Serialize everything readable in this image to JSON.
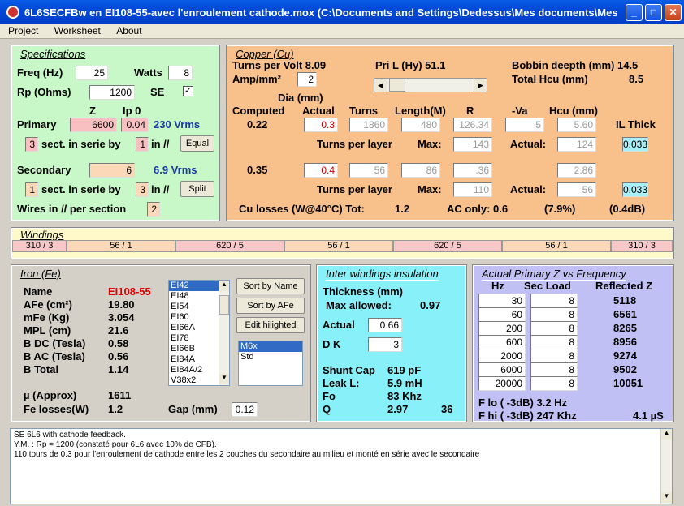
{
  "window": {
    "title": "6L6SECFBw en EI108-55-avec l'enroulement cathode.mox  (C:\\Documents and Settings\\Dedessus\\Mes documents\\Mes ...",
    "min": "_",
    "max": "□",
    "close": "✕"
  },
  "menu": [
    "Project",
    "Worksheet",
    "About"
  ],
  "spec": {
    "title": "Specifications",
    "freq_label": "Freq (Hz)",
    "freq": "25",
    "watts_label": "Watts",
    "watts": "8",
    "rp_label": "Rp (Ohms)",
    "rp": "1200",
    "se_label": "SE",
    "se_check": "✓",
    "z_label": "Z",
    "ip0_label": "Ip 0",
    "primary_label": "Primary",
    "primary_z": "6600",
    "primary_ip0": "0.04",
    "primary_vrms": "230 Vrms",
    "p_sect": "3",
    "sect_label": "sect. in serie by",
    "p_par": "1",
    "in_label": "in //",
    "equal": "Equal",
    "secondary_label": "Secondary",
    "secondary_z": "6",
    "secondary_vrms": "6.9 Vrms",
    "s_sect": "1",
    "s_par": "3",
    "split": "Split",
    "wires_label": "Wires in // per section",
    "wires": "2"
  },
  "copper": {
    "title": "Copper (Cu)",
    "tpv": "Turns per Volt  8.09",
    "pri_l": "Pri L (Hy)  51.1",
    "bobbin": "Bobbin deepth (mm) 14.5",
    "amp_label": "Amp/mm²",
    "amp": "2",
    "total_hcu": "Total Hcu (mm)",
    "total_hcu_val": "8.5",
    "dia": "Dia (mm)",
    "h_computed": "Computed",
    "h_actual": "Actual",
    "h_turns": "Turns",
    "h_length": "Length(M)",
    "h_r": "R",
    "h_va": "-Va",
    "h_hcu": "Hcu (mm)",
    "il_thick": "IL Thick",
    "r1": {
      "computed": "0.22",
      "actual": "0.3",
      "turns": "1860",
      "length": "480",
      "r": "126.34",
      "va": "5",
      "hcu": "5.60"
    },
    "tpl": "Turns per layer",
    "max": "Max:",
    "actual_lbl": "Actual:",
    "r1b": {
      "max": "143",
      "actual": "124",
      "il": "0.033"
    },
    "r2": {
      "computed": "0.35",
      "actual": "0.4",
      "turns": "56",
      "length": "86",
      "r": ".36",
      "hcu": "2.86"
    },
    "r2b": {
      "max": "110",
      "actual": "56",
      "il": "0.033"
    },
    "losses": "Cu losses (W@40°C) Tot:",
    "tot": "1.2",
    "ac_only": "AC only:  0.6",
    "pct": "(7.9%)",
    "db": "(0.4dB)"
  },
  "windings": {
    "title": "Windings",
    "cells": [
      "310 / 3",
      "56 / 1",
      "620 / 5",
      "56 / 1",
      "620 / 5",
      "56 / 1",
      "310 / 3"
    ]
  },
  "iron": {
    "title": "Iron (Fe)",
    "rows": [
      [
        "Name",
        "EI108-55"
      ],
      [
        "AFe (cm²)",
        "19.80"
      ],
      [
        "mFe (Kg)",
        "3.054"
      ],
      [
        "MPL (cm)",
        "21.6"
      ],
      [
        "B DC (Tesla)",
        "0.58"
      ],
      [
        "B AC (Tesla)",
        "0.56"
      ],
      [
        "B Total",
        "1.14"
      ]
    ],
    "mu": "µ (Approx)",
    "mu_val": "1611",
    "fe_label": "Fe losses(W)",
    "fe_val": "1.2",
    "gap_label": "Gap (mm)",
    "gap": "0.12",
    "cores": [
      "EI42",
      "EI48",
      "EI54",
      "EI60",
      "EI66A",
      "EI78",
      "EI66B",
      "EI84A",
      "EI84A/2",
      "V38x2"
    ],
    "sort_name": "Sort by Name",
    "sort_afe": "Sort by AFe",
    "edit": "Edit hilighted",
    "grades": [
      "M6x",
      "Std"
    ]
  },
  "inter": {
    "title": "Inter windings insulation",
    "thick": "Thickness (mm)",
    "max_allowed": "Max allowed:",
    "max_val": "0.97",
    "actual_label": "Actual",
    "actual": "0.66",
    "dk_label": "D K",
    "dk": "3",
    "shunt": "Shunt Cap",
    "shunt_val": "619 pF",
    "leak": "Leak L:",
    "leak_val": "5.9 mH",
    "fo": "Fo",
    "fo_val": "83 Khz",
    "q": "Q",
    "q_val": "2.97",
    "q2": "36"
  },
  "zf": {
    "title": "Actual Primary Z vs Frequency",
    "h_hz": "Hz",
    "h_load": "Sec Load",
    "h_refl": "Reflected Z",
    "rows": [
      [
        "30",
        "8",
        "5118"
      ],
      [
        "60",
        "8",
        "6561"
      ],
      [
        "200",
        "8",
        "8265"
      ],
      [
        "600",
        "8",
        "8956"
      ],
      [
        "2000",
        "8",
        "9274"
      ],
      [
        "6000",
        "8",
        "9502"
      ],
      [
        "20000",
        "8",
        "10051"
      ]
    ],
    "flo": "F lo ( -3dB) 3.2 Hz",
    "fhi": "F hi ( -3dB) 247 Khz",
    "rise": "4.1 µS"
  },
  "notes": [
    "SE 6L6 with cathode feedback.",
    "Y.M. : Rp = 1200 (constaté pour 6L6 avec 10% de CFB).",
    "110 tours de 0.3 pour l'enroulement de cathode entre les 2 couches du secondaire au milieu et monté en série avec le secondaire"
  ]
}
